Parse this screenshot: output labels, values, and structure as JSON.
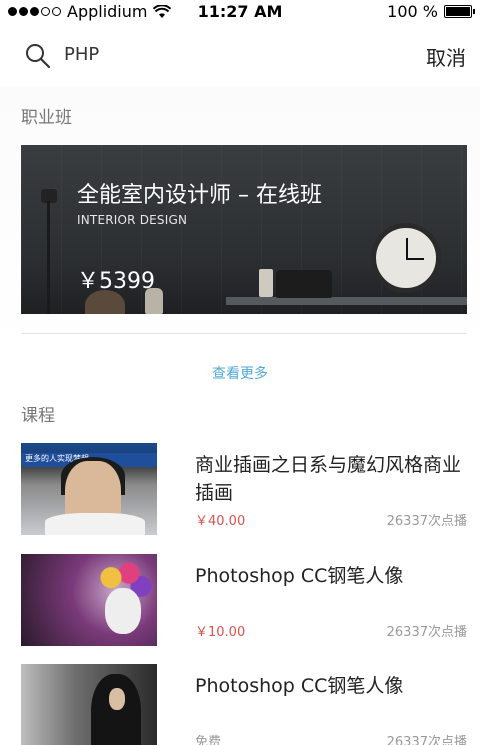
{
  "status_bar": {
    "carrier": "Applidium",
    "time": "11:27 AM",
    "battery": "100 %"
  },
  "search": {
    "query": "PHP",
    "cancel_label": "取消"
  },
  "career_section": {
    "title": "职业班",
    "banner": {
      "title": "全能室内设计师 – 在线班",
      "subtitle": "INTERIOR DESIGN",
      "price": "￥5399"
    },
    "more_label": "查看更多"
  },
  "courses_section": {
    "title": "课程",
    "items": [
      {
        "title": "商业插画之日系与魔幻风格商业插画",
        "price": "￥40.00",
        "views": "26337次点播",
        "thumb_text": "更多的人实现梦想"
      },
      {
        "title": "Photoshop CC钢笔人像",
        "price": "￥10.00",
        "views": "26337次点播"
      },
      {
        "title": "Photoshop CC钢笔人像",
        "price": "免费",
        "views": "26337次点播"
      }
    ]
  }
}
